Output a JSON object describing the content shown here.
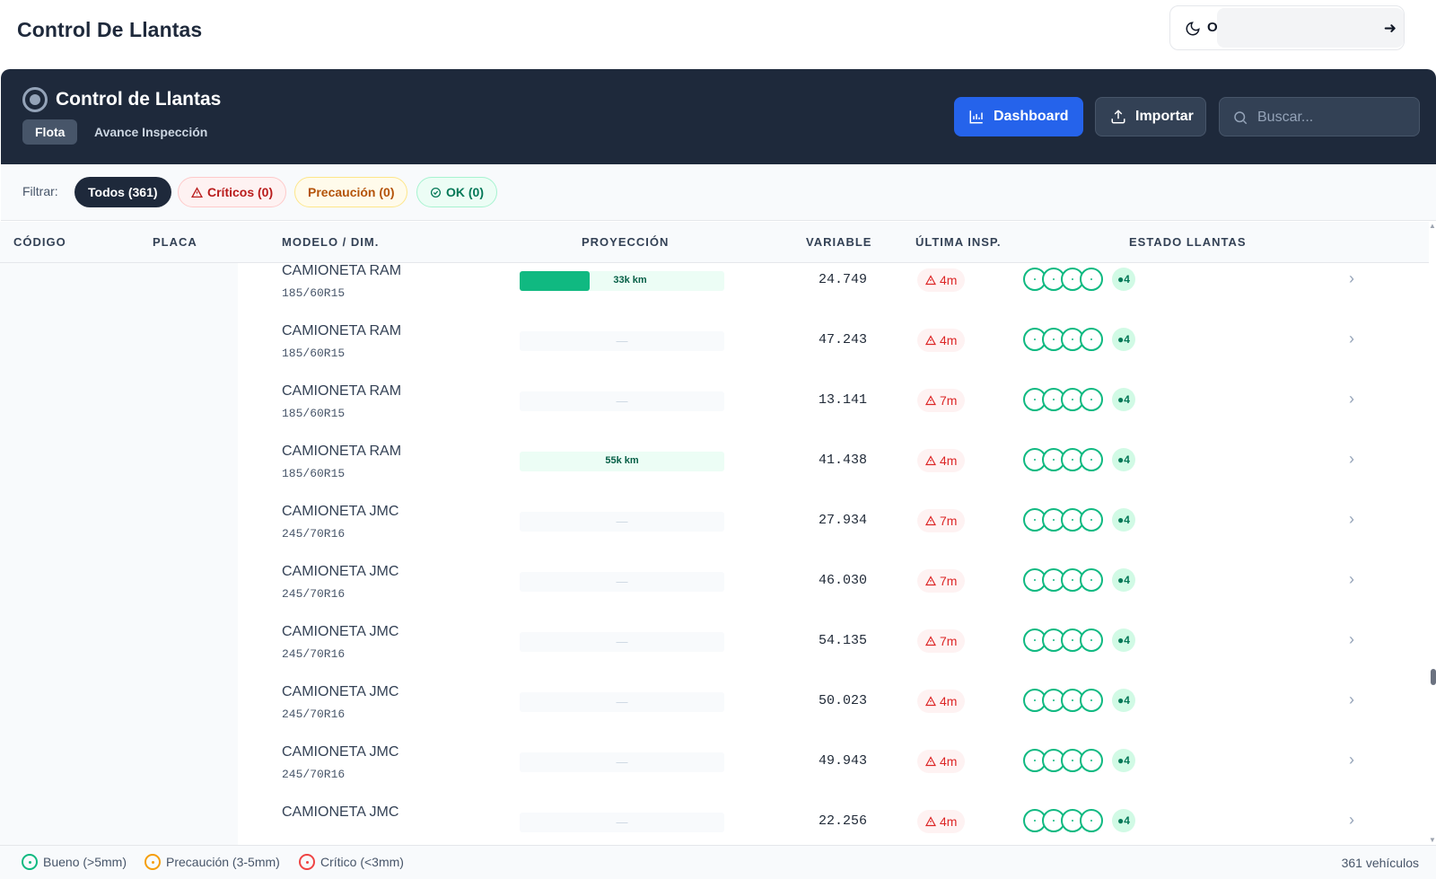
{
  "page": {
    "title": "Control De Llantas"
  },
  "user": {
    "initial": "O",
    "logout_icon": "arrow-right-icon"
  },
  "header": {
    "title": "Control de Llantas",
    "tabs": [
      {
        "label": "Flota",
        "active": true
      },
      {
        "label": "Avance Inspección",
        "active": false
      }
    ],
    "dashboard_label": "Dashboard",
    "import_label": "Importar",
    "search_placeholder": "Buscar..."
  },
  "filters": {
    "label": "Filtrar:",
    "todos": "Todos (361)",
    "criticos": "Críticos (0)",
    "precaucion": "Precaución (0)",
    "ok": "OK (0)"
  },
  "table": {
    "columns": [
      "CÓDIGO",
      "PLACA",
      "MODELO / DIM.",
      "PROYECCIÓN",
      "VARIABLE",
      "ÚLTIMA INSP.",
      "ESTADO LLANTAS"
    ],
    "rows": [
      {
        "model": "CAMIONETA RAM",
        "dim": "185/60R15",
        "proj_text": "33k km",
        "proj_fraction": 0.34,
        "variable": "24.749",
        "insp": "4m",
        "ok_count": "●4"
      },
      {
        "model": "CAMIONETA RAM",
        "dim": "185/60R15",
        "proj_text": "—",
        "proj_fraction": null,
        "variable": "47.243",
        "insp": "4m",
        "ok_count": "●4"
      },
      {
        "model": "CAMIONETA RAM",
        "dim": "185/60R15",
        "proj_text": "—",
        "proj_fraction": null,
        "variable": "13.141",
        "insp": "7m",
        "ok_count": "●4"
      },
      {
        "model": "CAMIONETA RAM",
        "dim": "185/60R15",
        "proj_text": "55k km",
        "proj_fraction": 0,
        "variable": "41.438",
        "insp": "4m",
        "ok_count": "●4"
      },
      {
        "model": "CAMIONETA JMC",
        "dim": "245/70R16",
        "proj_text": "—",
        "proj_fraction": null,
        "variable": "27.934",
        "insp": "7m",
        "ok_count": "●4"
      },
      {
        "model": "CAMIONETA JMC",
        "dim": "245/70R16",
        "proj_text": "—",
        "proj_fraction": null,
        "variable": "46.030",
        "insp": "7m",
        "ok_count": "●4"
      },
      {
        "model": "CAMIONETA JMC",
        "dim": "245/70R16",
        "proj_text": "—",
        "proj_fraction": null,
        "variable": "54.135",
        "insp": "7m",
        "ok_count": "●4"
      },
      {
        "model": "CAMIONETA JMC",
        "dim": "245/70R16",
        "proj_text": "—",
        "proj_fraction": null,
        "variable": "50.023",
        "insp": "4m",
        "ok_count": "●4"
      },
      {
        "model": "CAMIONETA JMC",
        "dim": "245/70R16",
        "proj_text": "—",
        "proj_fraction": null,
        "variable": "49.943",
        "insp": "4m",
        "ok_count": "●4"
      },
      {
        "model": "CAMIONETA JMC",
        "dim": "",
        "proj_text": "—",
        "proj_fraction": null,
        "variable": "22.256",
        "insp": "4m",
        "ok_count": "●4"
      }
    ]
  },
  "footer": {
    "legend": [
      "Bueno (>5mm)",
      "Precaución (3-5mm)",
      "Crítico (<3mm)"
    ],
    "count": "361 vehículos"
  },
  "colors": {
    "header_bg": "#1e293b",
    "accent": "#2563eb",
    "ok": "#10b981",
    "warning": "#f59e0b",
    "critical": "#ef4444"
  }
}
